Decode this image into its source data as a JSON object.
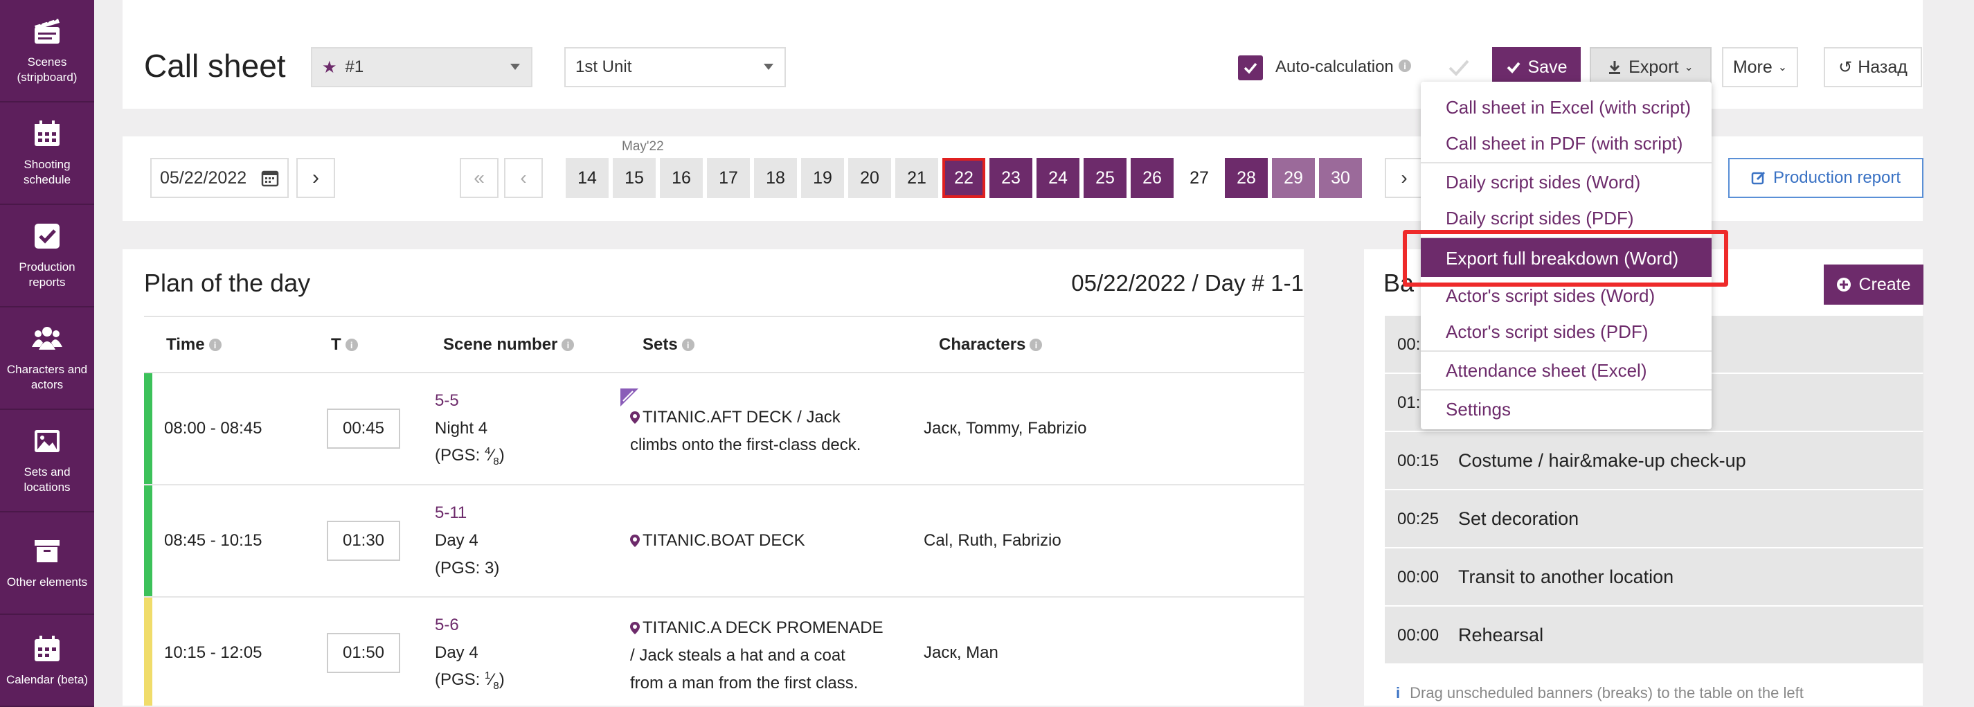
{
  "sidebar": {
    "items": [
      {
        "label": "Scenes (stripboard)",
        "icon": "clapperboard-icon"
      },
      {
        "label": "Shooting schedule",
        "icon": "calendar-icon"
      },
      {
        "label": "Production reports",
        "icon": "checkbox-icon"
      },
      {
        "label": "Characters and actors",
        "icon": "users-icon"
      },
      {
        "label": "Sets and locations",
        "icon": "image-icon"
      },
      {
        "label": "Other elements",
        "icon": "box-icon"
      },
      {
        "label": "Calendar (beta)",
        "icon": "calendar-icon"
      }
    ]
  },
  "header": {
    "title": "Call sheet",
    "callsheet_select": "#1",
    "unit_select": "1st Unit",
    "auto_calc_label": "Auto-calculation",
    "save_label": "Save",
    "export_label": "Export",
    "more_label": "More",
    "back_label": "Назад"
  },
  "datebar": {
    "date_value": "05/22/2022",
    "month_label": "May'22",
    "days": [
      "14",
      "15",
      "16",
      "17",
      "18",
      "19",
      "20",
      "21",
      "22",
      "23",
      "24",
      "25",
      "26",
      "27",
      "28",
      "29",
      "30"
    ],
    "next_label": "›",
    "first_label": "«",
    "prev_label": "‹",
    "production_report_label": "Production report"
  },
  "export_menu": {
    "items": [
      "Call sheet in Excel (with script)",
      "Call sheet in PDF (with script)",
      "Daily script sides (Word)",
      "Daily script sides (PDF)",
      "Export full breakdown (Word)",
      "Actor's script sides (Word)",
      "Actor's script sides (PDF)",
      "Attendance sheet (Excel)",
      "Settings"
    ],
    "highlighted_index": 4
  },
  "plan": {
    "title": "Plan of the day",
    "day_info": "05/22/2022 / Day # 1-1",
    "headers": {
      "time": "Time",
      "t": "T",
      "scene": "Scene number",
      "sets": "Sets",
      "characters": "Characters"
    },
    "rows": [
      {
        "time": "08:00 - 08:45",
        "t": "00:45",
        "scene_num": "5-5",
        "scene_line2": "Night 4",
        "pgs_pre": "(PGS: ",
        "pgs_num": "4",
        "pgs_den": "8",
        "pgs_post": ")",
        "set_line1": "TITANIC.AFT DECK / Jack",
        "set_line2": "climbs onto the first-class deck.",
        "set_line3": "",
        "characters": "Jacк, Tommy, Fabrizio",
        "bar_color": "#3cc15a"
      },
      {
        "time": "08:45 - 10:15",
        "t": "01:30",
        "scene_num": "5-11",
        "scene_line2": "Day 4",
        "pgs_text": "(PGS: 3)",
        "set_line1": "TITANIC.BOAT DECK",
        "characters": "Cal, Ruth, Fabrizio",
        "bar_color": "#3cc15a"
      },
      {
        "time": "10:15 - 12:05",
        "t": "01:50",
        "scene_num": "5-6",
        "scene_line2": "Day 4",
        "pgs_pre": "(PGS: ",
        "pgs_num": "1",
        "pgs_den": "8",
        "pgs_post": ")",
        "set_line1": "TITANIC.A DECK PROMENADE",
        "set_line2": "/ Jack steals a hat and a coat",
        "set_line3": "from a man from the first class.",
        "characters": "Jacк, Man",
        "bar_color": "#f0dc6a"
      }
    ]
  },
  "banners": {
    "title_partial": "Ba",
    "create_label": "Create",
    "rows": [
      {
        "time": "00:",
        "name": ""
      },
      {
        "time": "01:",
        "name": ""
      },
      {
        "time": "00:15",
        "name": "Costume / hair&make-up check-up"
      },
      {
        "time": "00:25",
        "name": "Set decoration"
      },
      {
        "time": "00:00",
        "name": "Transit to another location"
      },
      {
        "time": "00:00",
        "name": "Rehearsal"
      }
    ],
    "hint": "Drag unscheduled banners (breaks) to the table on the left"
  }
}
